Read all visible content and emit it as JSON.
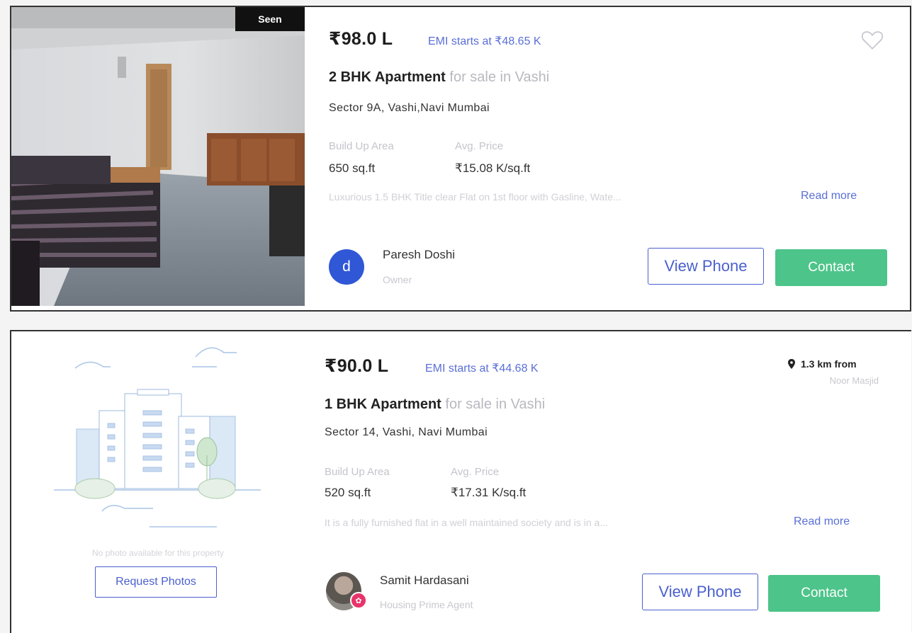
{
  "listings": [
    {
      "seen_label": "Seen",
      "price": "₹98.0 L",
      "emi": "EMI starts at ₹48.65 K",
      "bhk": "2 BHK Apartment",
      "sale_text": "for sale in Vashi",
      "address": "Sector 9A, Vashi,Navi Mumbai",
      "area_label": "Build Up Area",
      "area_value": "650 sq.ft",
      "avg_label": "Avg. Price",
      "avg_value": "₹15.08 K/sq.ft",
      "description": "Luxurious 1.5 BHK Title clear Flat on 1st floor with Gasline, Wate...",
      "read_more": "Read more",
      "avatar_letter": "d",
      "owner_name": "Paresh Doshi",
      "owner_role": "Owner",
      "view_phone": "View Phone",
      "contact": "Contact"
    },
    {
      "price": "₹90.0 L",
      "emi": "EMI starts at ₹44.68 K",
      "distance": "1.3 km from",
      "distance_place": "Noor Masjid",
      "bhk": "1 BHK Apartment",
      "sale_text": "for sale in Vashi",
      "address": "Sector 14, Vashi, Navi Mumbai",
      "area_label": "Build Up Area",
      "area_value": "520 sq.ft",
      "avg_label": "Avg. Price",
      "avg_value": "₹17.31 K/sq.ft",
      "description": "It is a fully furnished flat in a well maintained society and is in a...",
      "read_more": "Read more",
      "no_photo_text": "No photo available for this property",
      "request_photos": "Request Photos",
      "owner_name": "Samit Hardasani",
      "owner_role": "Housing Prime Agent",
      "view_phone": "View Phone",
      "contact": "Contact"
    }
  ],
  "icons": {
    "wishlist": "heart-outline-icon",
    "location": "map-pin-icon",
    "agent_badge": "prime-badge-icon"
  },
  "colors": {
    "accent": "#4a5fcf",
    "contact": "#4dc48a",
    "avatar": "#2f57d6"
  }
}
